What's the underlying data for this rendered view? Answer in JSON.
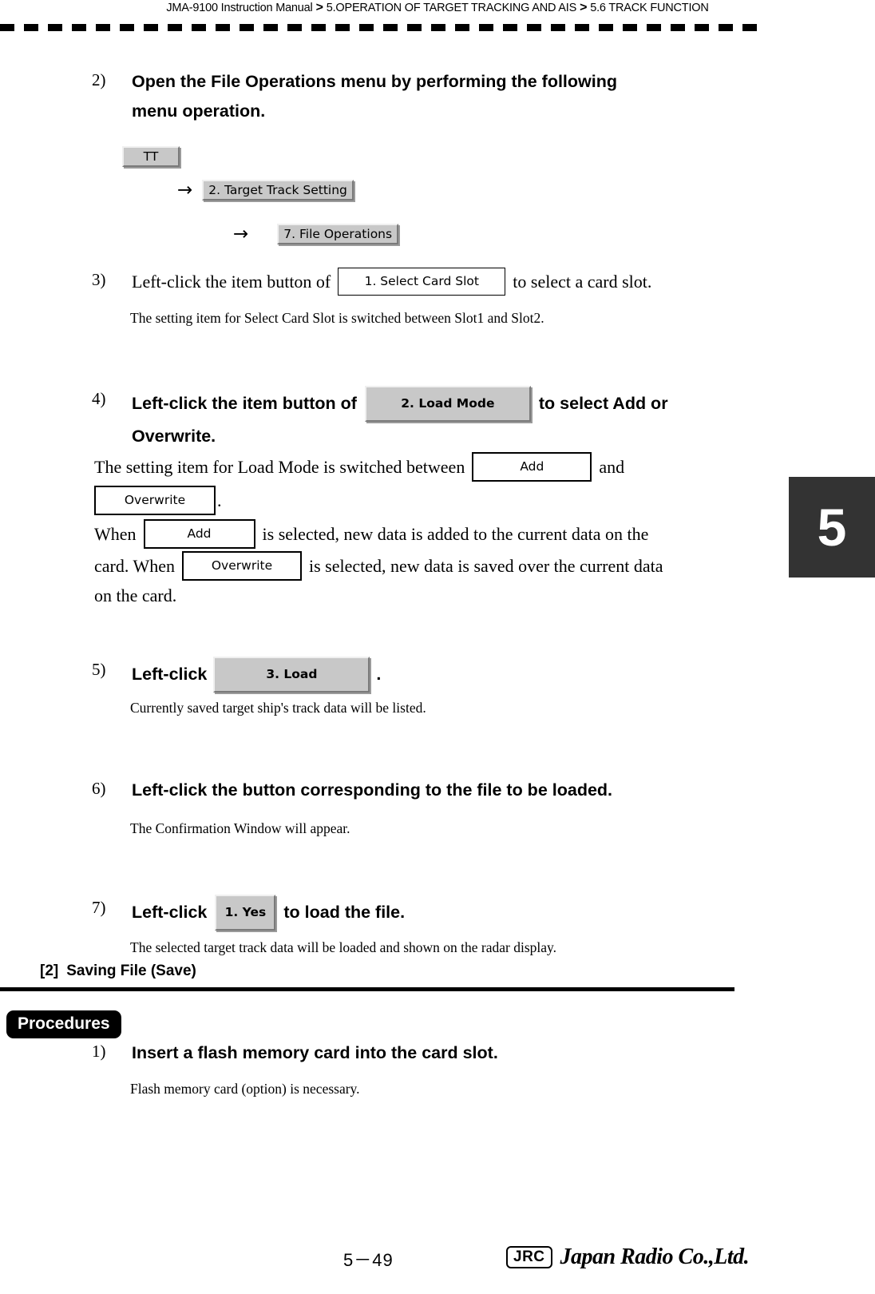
{
  "header": {
    "manual": "JMA-9100 Instruction Manual",
    "sep1": ">",
    "chapter": "5.OPERATION OF TARGET TRACKING AND AIS",
    "sep2": ">",
    "section": "5.6  TRACK FUNCTION"
  },
  "chapter_tab": {
    "number": "5"
  },
  "steps": {
    "s2": {
      "num": "2)",
      "title_line1": "Open the File Operations menu by performing the following",
      "title_line2": "menu operation.",
      "menu_path": {
        "btn1": "TT",
        "arrow1": "→",
        "btn2": "2. Target Track Setting",
        "arrow2": "→",
        "btn3": "7. File Operations"
      }
    },
    "s3": {
      "num": "3)",
      "text_before": "Left-click the item button of",
      "button": "1. Select Card Slot",
      "text_after": "to select a card slot.",
      "note": "The setting item for Select Card Slot is switched between Slot1 and Slot2."
    },
    "s4": {
      "num": "4)",
      "text_before": "Left-click the item button of",
      "button": "2. Load Mode",
      "text_after": "to select Add or",
      "title_line2": "Overwrite.",
      "p1_a": "The setting item for Load Mode is switched between",
      "p1_btn_add": "Add",
      "p1_b": "and",
      "p1_btn_overwrite": "Overwrite",
      "p1_c": ".",
      "p2_a": "When",
      "p2_btn_add": "Add",
      "p2_b": "is selected, new data is added to the current data on the",
      "p2_c": "card. When",
      "p2_btn_overwrite": "Overwrite",
      "p2_d": "is selected, new data is saved over the current data",
      "p2_e": "on the card."
    },
    "s5": {
      "num": "5)",
      "text_before": "Left-click",
      "button": "3. Load",
      "text_after": ".",
      "note": "Currently saved target ship's track data will be listed."
    },
    "s6": {
      "num": "6)",
      "title": "Left-click the button corresponding to the file to be loaded.",
      "note": "The Confirmation Window will appear."
    },
    "s7": {
      "num": "7)",
      "text_before": "Left-click",
      "button": "1. Yes",
      "text_after": "to load the file.",
      "note": "The selected target track data will be loaded and shown on the radar display."
    }
  },
  "section2": {
    "number": "[2]",
    "title": "Saving File (Save)",
    "procedures_badge": "Procedures",
    "step1": {
      "num": "1)",
      "title": "Insert a flash memory card into the card slot.",
      "note": "Flash memory card (option) is necessary."
    }
  },
  "footer": {
    "page_number": "5－49",
    "logo_mark": "JRC",
    "logo_name": "Japan Radio Co.,Ltd."
  },
  "colors": {
    "button_face": "#c8c8c8",
    "tab_background": "#333333",
    "ink": "#000000"
  }
}
